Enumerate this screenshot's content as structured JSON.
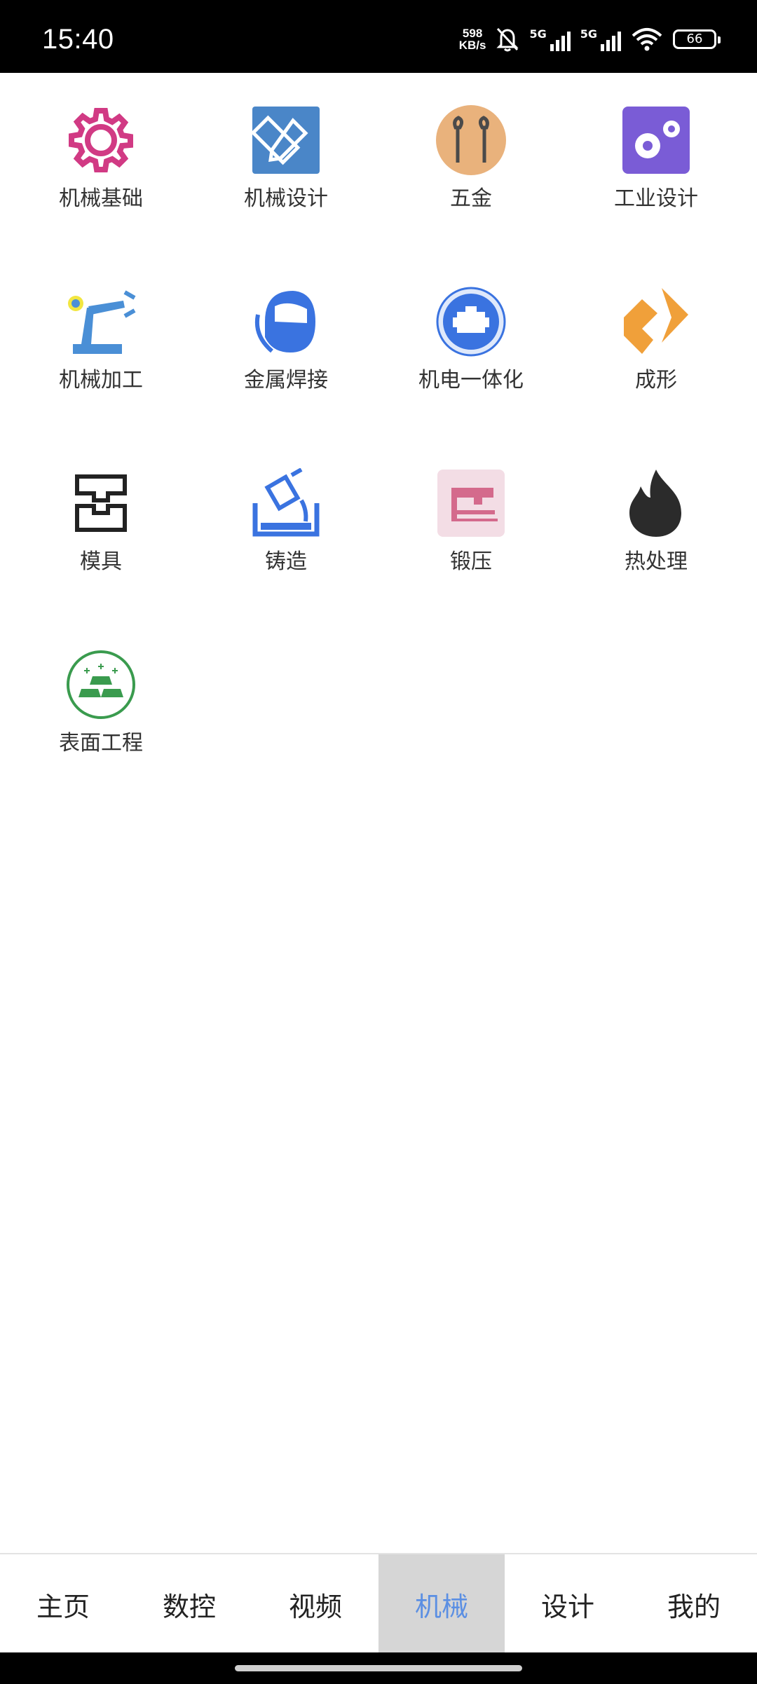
{
  "status_bar": {
    "time": "15:40",
    "net_speed_value": "598",
    "net_speed_unit": "KB/s",
    "network1": "5G",
    "network2": "5G",
    "battery": "66"
  },
  "grid": {
    "items": [
      {
        "label": "机械基础",
        "icon": "gear-icon"
      },
      {
        "label": "机械设计",
        "icon": "design-tools-icon"
      },
      {
        "label": "五金",
        "icon": "wrench-icon"
      },
      {
        "label": "工业设计",
        "icon": "gears-icon"
      },
      {
        "label": "机械加工",
        "icon": "robot-arm-icon"
      },
      {
        "label": "金属焊接",
        "icon": "welding-mask-icon"
      },
      {
        "label": "机电一体化",
        "icon": "engine-icon"
      },
      {
        "label": "成形",
        "icon": "forming-icon"
      },
      {
        "label": "模具",
        "icon": "mold-icon"
      },
      {
        "label": "铸造",
        "icon": "casting-icon"
      },
      {
        "label": "锻压",
        "icon": "forging-press-icon"
      },
      {
        "label": "热处理",
        "icon": "flame-icon"
      },
      {
        "label": "表面工程",
        "icon": "gold-bars-icon"
      }
    ]
  },
  "bottom_nav": {
    "tabs": [
      {
        "label": "主页"
      },
      {
        "label": "数控"
      },
      {
        "label": "视频"
      },
      {
        "label": "机械",
        "active": true
      },
      {
        "label": "设计"
      },
      {
        "label": "我的"
      }
    ]
  },
  "colors": {
    "active_tab_text": "#5b8fe3",
    "active_tab_bg": "#d6d6d6"
  }
}
